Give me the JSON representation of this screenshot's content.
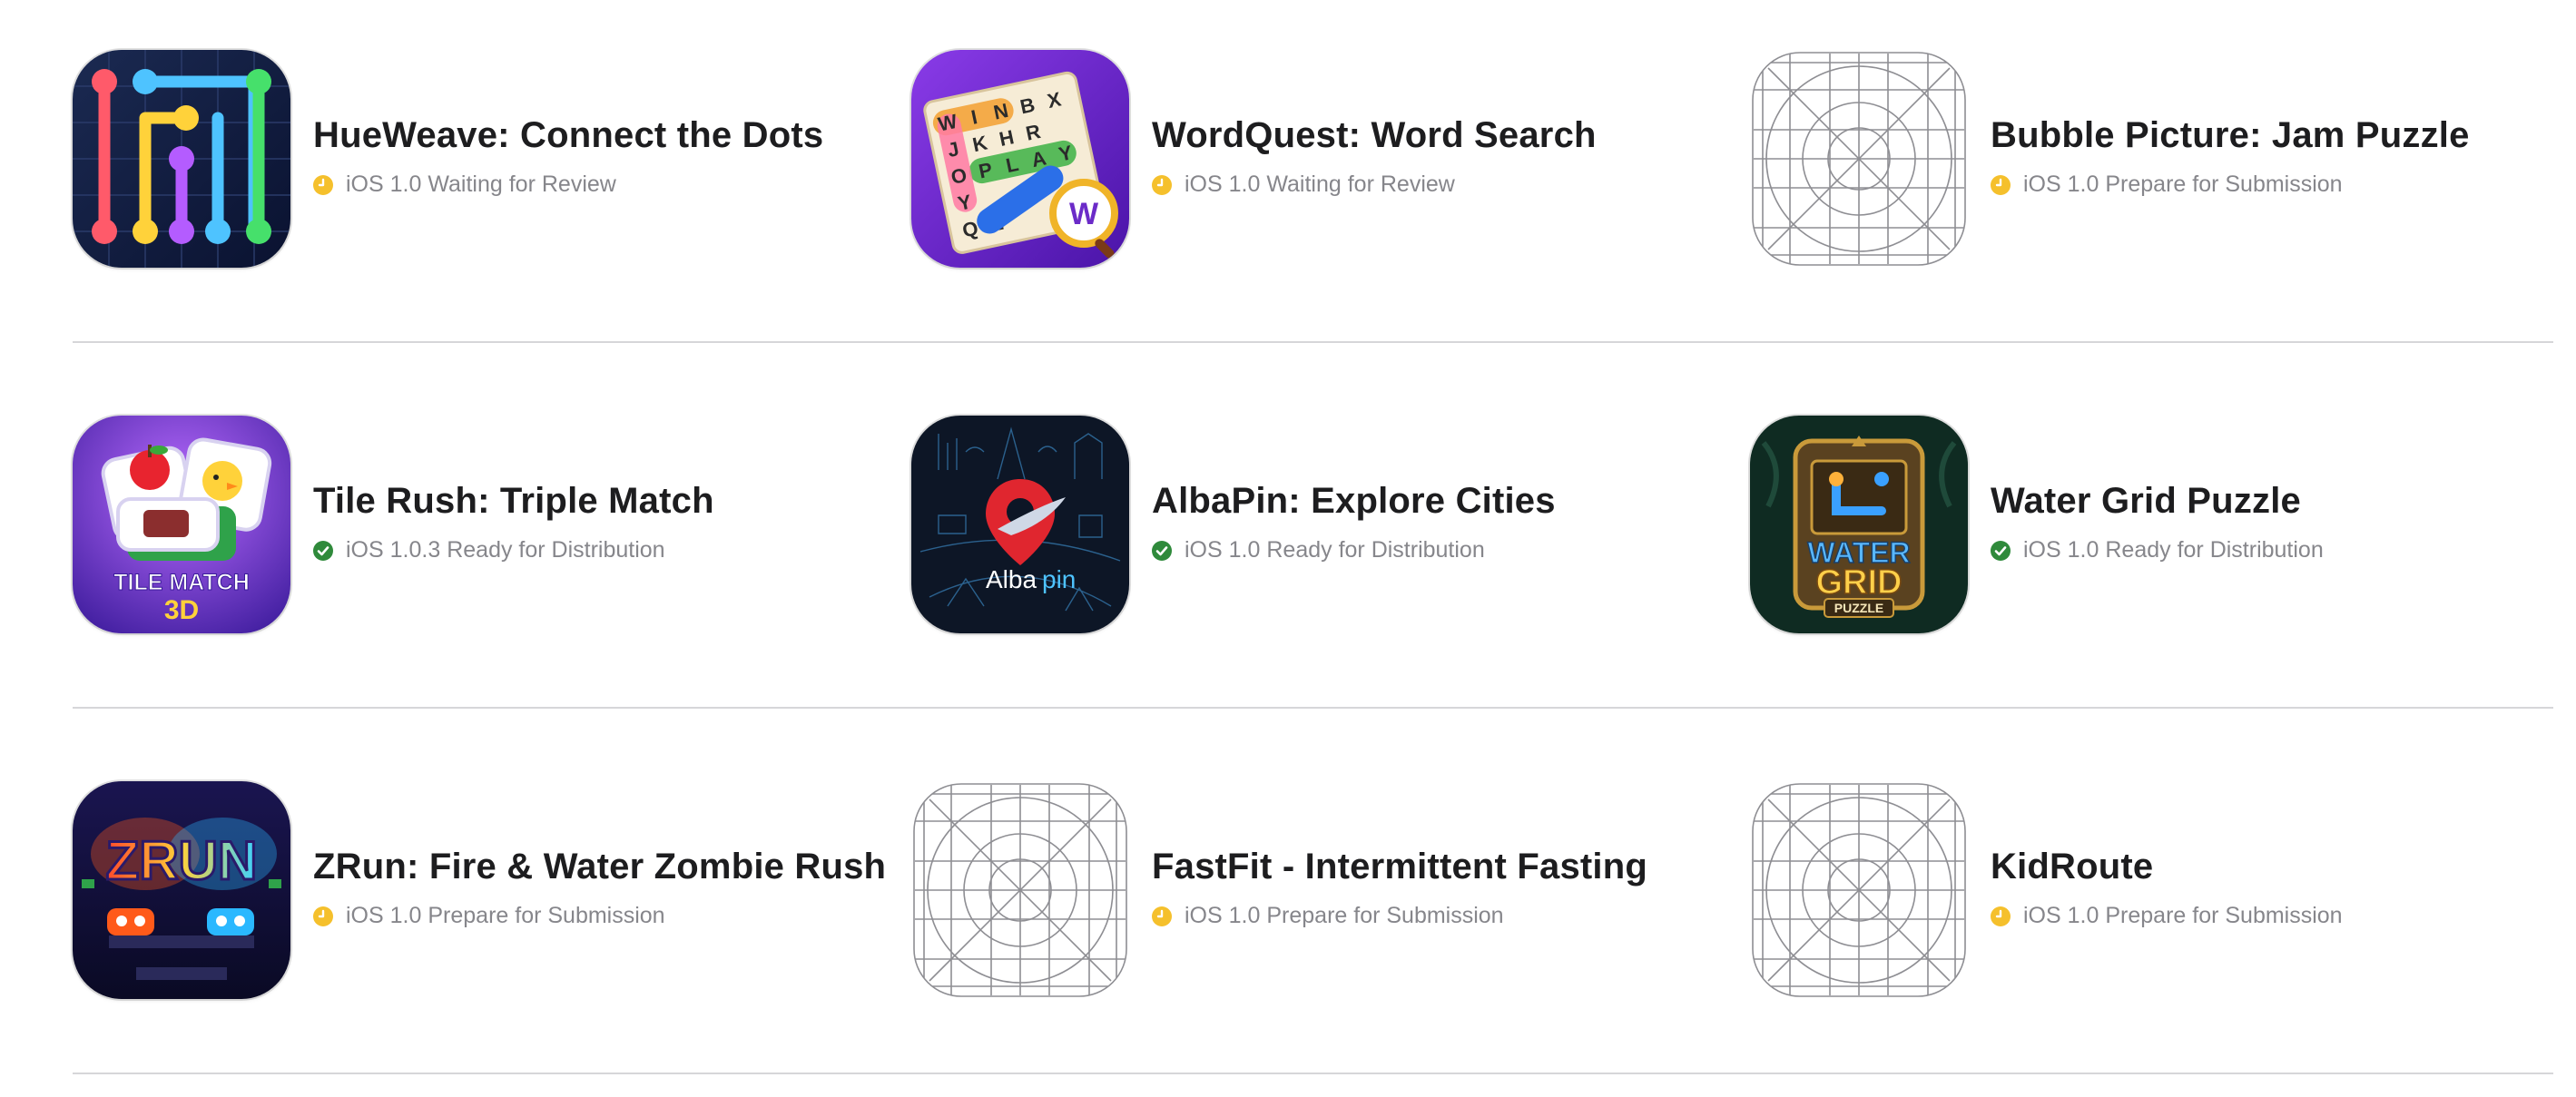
{
  "apps": [
    {
      "name": "HueWeave: Connect the Dots",
      "platform": "iOS",
      "version": "1.0",
      "status": "Waiting for Review",
      "status_kind": "pending",
      "icon": "hueweave-icon"
    },
    {
      "name": "WordQuest: Word Search",
      "platform": "iOS",
      "version": "1.0",
      "status": "Waiting for Review",
      "status_kind": "pending",
      "icon": "wordquest-icon"
    },
    {
      "name": "Bubble Picture: Jam Puzzle",
      "platform": "iOS",
      "version": "1.0",
      "status": "Prepare for Submission",
      "status_kind": "pending",
      "icon": "placeholder-icon"
    },
    {
      "name": "Tile Rush: Triple Match",
      "platform": "iOS",
      "version": "1.0.3",
      "status": "Ready for Distribution",
      "status_kind": "ready",
      "icon": "tile-rush-icon",
      "icon_text": [
        "TILE MATCH",
        "3D"
      ]
    },
    {
      "name": "AlbaPin: Explore Cities",
      "platform": "iOS",
      "version": "1.0",
      "status": "Ready for Distribution",
      "status_kind": "ready",
      "icon": "albapin-icon",
      "icon_text": [
        "Alba",
        "pin"
      ]
    },
    {
      "name": "Water Grid Puzzle",
      "platform": "iOS",
      "version": "1.0",
      "status": "Ready for Distribution",
      "status_kind": "ready",
      "icon": "water-grid-icon",
      "icon_text": [
        "WATER",
        "GRID",
        "PUZZLE"
      ]
    },
    {
      "name": "ZRun: Fire & Water Zombie Rush",
      "platform": "iOS",
      "version": "1.0",
      "status": "Prepare for Submission",
      "status_kind": "pending",
      "icon": "zrun-icon",
      "icon_text": [
        "ZRUN"
      ]
    },
    {
      "name": "FastFit - Intermittent Fasting",
      "platform": "iOS",
      "version": "1.0",
      "status": "Prepare for Submission",
      "status_kind": "pending",
      "icon": "placeholder-icon"
    },
    {
      "name": "KidRoute",
      "platform": "iOS",
      "version": "1.0",
      "status": "Prepare for Submission",
      "status_kind": "pending",
      "icon": "placeholder-icon"
    }
  ],
  "colors": {
    "pending": "#f5c02c",
    "ready": "#2f8a3b",
    "divider": "#d6d6d9",
    "title": "#1d1d1f",
    "subtitle": "#86868b"
  }
}
